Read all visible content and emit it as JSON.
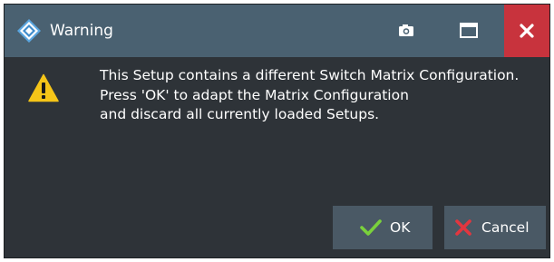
{
  "window": {
    "title": "Warning",
    "title_icon": "rs-logo-icon",
    "titlebar_buttons": [
      "camera-icon",
      "maximize-icon",
      "close-icon"
    ]
  },
  "message": {
    "icon": "warning-triangle-icon",
    "lines": [
      "This Setup contains a different Switch Matrix Configuration.",
      "Press 'OK' to adapt the Matrix Configuration",
      "and discard all currently loaded Setups."
    ]
  },
  "buttons": {
    "ok_label": "OK",
    "cancel_label": "Cancel"
  },
  "colors": {
    "titlebar": "#4a6171",
    "background": "#2e3338",
    "close_button": "#c8333d",
    "button": "#4a5965",
    "ok_check": "#7ad13c",
    "cancel_x": "#e2363f",
    "warning": "#f5c518"
  }
}
